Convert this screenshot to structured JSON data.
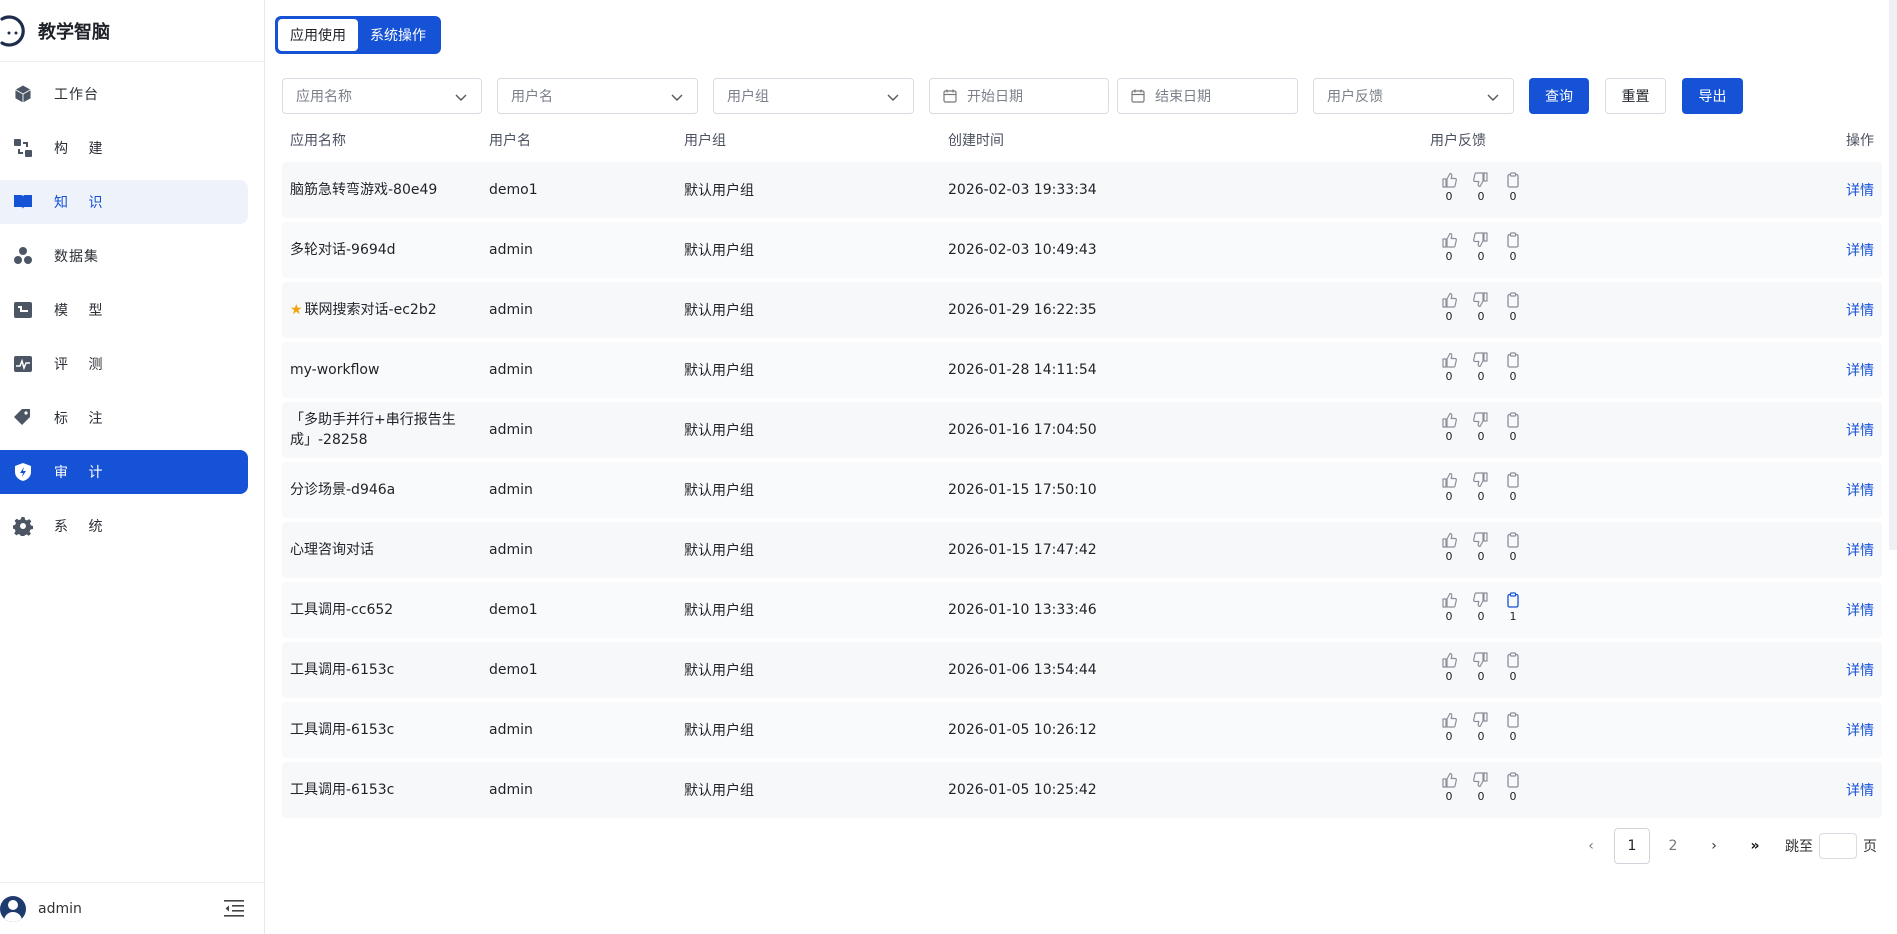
{
  "brand": {
    "title": "教学智脑"
  },
  "sidebar": {
    "items": [
      {
        "label": "工作台",
        "icon": "cube-icon",
        "state": "normal"
      },
      {
        "label": "构 建",
        "icon": "build-icon",
        "state": "normal"
      },
      {
        "label": "知 识",
        "icon": "book-icon",
        "state": "soft"
      },
      {
        "label": "数据集",
        "icon": "dataset-icon",
        "state": "normal"
      },
      {
        "label": "模 型",
        "icon": "model-icon",
        "state": "normal"
      },
      {
        "label": "评 测",
        "icon": "chart-icon",
        "state": "normal"
      },
      {
        "label": "标 注",
        "icon": "tag-icon",
        "state": "normal"
      },
      {
        "label": "审 计",
        "icon": "shield-icon",
        "state": "active"
      },
      {
        "label": "系 统",
        "icon": "gear-icon",
        "state": "normal"
      }
    ],
    "user": "admin"
  },
  "tabs": {
    "app_use": "应用使用",
    "sys_ops": "系统操作"
  },
  "filters": {
    "app_name": "应用名称",
    "user_name": "用户名",
    "user_group": "用户组",
    "start_date": "开始日期",
    "end_date": "结束日期",
    "feedback": "用户反馈",
    "query": "查询",
    "reset": "重置",
    "export": "导出"
  },
  "table": {
    "headers": {
      "name": "应用名称",
      "user": "用户名",
      "group": "用户组",
      "time": "创建时间",
      "feedback": "用户反馈",
      "op": "操作"
    },
    "op_label": "详情",
    "rows": [
      {
        "name": "脑筋急转弯游戏-80e49",
        "user": "demo1",
        "group": "默认用户组",
        "time": "2026-02-03 19:33:34",
        "like": "0",
        "dislike": "0",
        "note": "0",
        "star": false,
        "note_active": false
      },
      {
        "name": "多轮对话-9694d",
        "user": "admin",
        "group": "默认用户组",
        "time": "2026-02-03 10:49:43",
        "like": "0",
        "dislike": "0",
        "note": "0",
        "star": false,
        "note_active": false
      },
      {
        "name": "联网搜索对话-ec2b2",
        "user": "admin",
        "group": "默认用户组",
        "time": "2026-01-29 16:22:35",
        "like": "0",
        "dislike": "0",
        "note": "0",
        "star": true,
        "note_active": false
      },
      {
        "name": "my-workflow",
        "user": "admin",
        "group": "默认用户组",
        "time": "2026-01-28 14:11:54",
        "like": "0",
        "dislike": "0",
        "note": "0",
        "star": false,
        "note_active": false
      },
      {
        "name": "「多助手并行+串行报告生成」-28258",
        "user": "admin",
        "group": "默认用户组",
        "time": "2026-01-16 17:04:50",
        "like": "0",
        "dislike": "0",
        "note": "0",
        "star": false,
        "note_active": false
      },
      {
        "name": "分诊场景-d946a",
        "user": "admin",
        "group": "默认用户组",
        "time": "2026-01-15 17:50:10",
        "like": "0",
        "dislike": "0",
        "note": "0",
        "star": false,
        "note_active": false
      },
      {
        "name": "心理咨询对话",
        "user": "admin",
        "group": "默认用户组",
        "time": "2026-01-15 17:47:42",
        "like": "0",
        "dislike": "0",
        "note": "0",
        "star": false,
        "note_active": false
      },
      {
        "name": "工具调用-cc652",
        "user": "demo1",
        "group": "默认用户组",
        "time": "2026-01-10 13:33:46",
        "like": "0",
        "dislike": "0",
        "note": "1",
        "star": false,
        "note_active": true
      },
      {
        "name": "工具调用-6153c",
        "user": "demo1",
        "group": "默认用户组",
        "time": "2026-01-06 13:54:44",
        "like": "0",
        "dislike": "0",
        "note": "0",
        "star": false,
        "note_active": false
      },
      {
        "name": "工具调用-6153c",
        "user": "admin",
        "group": "默认用户组",
        "time": "2026-01-05 10:26:12",
        "like": "0",
        "dislike": "0",
        "note": "0",
        "star": false,
        "note_active": false
      },
      {
        "name": "工具调用-6153c",
        "user": "admin",
        "group": "默认用户组",
        "time": "2026-01-05 10:25:42",
        "like": "0",
        "dislike": "0",
        "note": "0",
        "star": false,
        "note_active": false
      }
    ]
  },
  "pager": {
    "prev": "‹",
    "pages": [
      "1",
      "2"
    ],
    "current": "1",
    "next": "›",
    "last": "»",
    "jump_label": "跳至",
    "page_unit": "页"
  }
}
